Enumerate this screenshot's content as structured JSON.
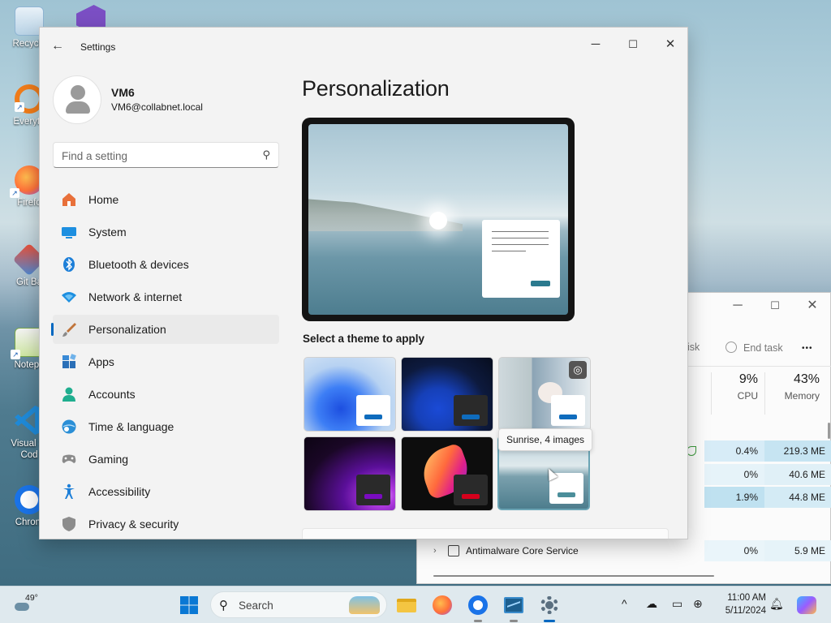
{
  "desktop": {
    "icons": [
      {
        "label": "Recycle",
        "icon": "recycle-bin-icon",
        "color": "#5aa0d8"
      },
      {
        "label": "Everyth",
        "icon": "everything-search-icon",
        "color": "#f07c1a"
      },
      {
        "label": "Firefo",
        "icon": "firefox-icon",
        "color": "#ff7139"
      },
      {
        "label": "Git Ba",
        "icon": "git-bash-icon",
        "color": "#f14e32"
      },
      {
        "label": "Notepa",
        "icon": "notepad-plus-plus-icon",
        "color": "#90c040"
      },
      {
        "label": "Visual St Cod",
        "icon": "vscode-icon",
        "color": "#1f8ad8"
      },
      {
        "label": "Chrom",
        "icon": "chrome-icon",
        "color": "#1a73e8"
      }
    ]
  },
  "settings": {
    "title": "Settings",
    "back_icon": "back-arrow-icon",
    "window_controls": {
      "minimize": "─",
      "maximize": "☐",
      "close": "✕"
    },
    "profile": {
      "name": "VM6",
      "email": "VM6@collabnet.local"
    },
    "search": {
      "placeholder": "Find a setting",
      "value": ""
    },
    "nav": [
      {
        "label": "Home",
        "icon": "home-icon"
      },
      {
        "label": "System",
        "icon": "system-icon"
      },
      {
        "label": "Bluetooth & devices",
        "icon": "bluetooth-icon"
      },
      {
        "label": "Network & internet",
        "icon": "wifi-icon"
      },
      {
        "label": "Personalization",
        "icon": "paintbrush-icon",
        "active": true
      },
      {
        "label": "Apps",
        "icon": "apps-icon"
      },
      {
        "label": "Accounts",
        "icon": "accounts-icon"
      },
      {
        "label": "Time & language",
        "icon": "globe-clock-icon"
      },
      {
        "label": "Gaming",
        "icon": "gamepad-icon"
      },
      {
        "label": "Accessibility",
        "icon": "accessibility-icon"
      },
      {
        "label": "Privacy & security",
        "icon": "shield-icon"
      }
    ],
    "page_title": "Personalization",
    "theme_section_label": "Select a theme to apply",
    "themes": [
      {
        "id": "windows-light",
        "accent": "#0f6cbd",
        "selected": false
      },
      {
        "id": "windows-dark",
        "accent": "#0f6cbd",
        "selected": false
      },
      {
        "id": "glow-flowers",
        "accent": "#0f6cbd",
        "selected": false
      },
      {
        "id": "glow",
        "accent": "#7a0bc0",
        "selected": false
      },
      {
        "id": "captured-motion",
        "accent": "#d6001c",
        "selected": false
      },
      {
        "id": "sunrise",
        "accent": "#4b8e9a",
        "selected": true
      }
    ],
    "tooltip": "Sunrise, 4 images"
  },
  "taskmanager": {
    "toolbar": {
      "run_task_partial": "isk",
      "end_task": "End task",
      "more": "•••"
    },
    "columns": {
      "cpu_pct": "9%",
      "cpu_label": "CPU",
      "mem_pct": "43%",
      "mem_label": "Memory"
    },
    "rows": [
      {
        "cpu": "0.4%",
        "mem": "219.3 ME"
      },
      {
        "cpu": "0%",
        "mem": "40.6 ME"
      },
      {
        "cpu": "1.9%",
        "mem": "44.8 ME"
      },
      {
        "name": "Antimalware Core Service",
        "cpu": "0%",
        "mem": "5.9 ME"
      }
    ]
  },
  "taskbar": {
    "weather_temp": "49°",
    "search_placeholder": "Search",
    "clock_time": "11:00 AM",
    "clock_date": "5/11/2024",
    "tray_chevron": "^"
  }
}
